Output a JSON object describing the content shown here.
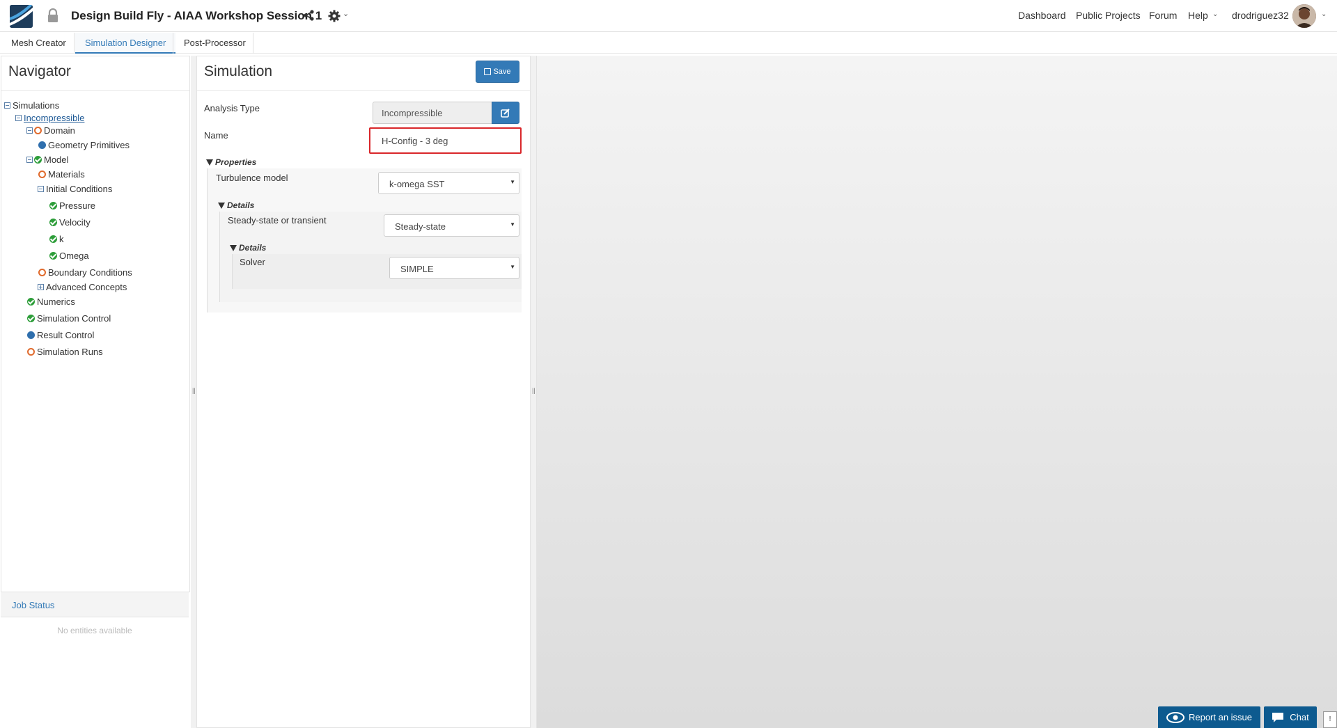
{
  "header": {
    "project_title": "Design Build Fly - AIAA Workshop Session 1",
    "nav": {
      "dashboard": "Dashboard",
      "public_projects": "Public Projects",
      "forum": "Forum",
      "help": "Help",
      "username": "drodriguez32"
    }
  },
  "tabs": [
    {
      "label": "Mesh Creator"
    },
    {
      "label": "Simulation Designer"
    },
    {
      "label": "Post-Processor"
    }
  ],
  "navigator": {
    "title": "Navigator",
    "tree": {
      "simulations": "Simulations",
      "incompressible": "Incompressible",
      "domain": "Domain",
      "geometry_primitives": "Geometry Primitives",
      "model": "Model",
      "materials": "Materials",
      "initial_conditions": "Initial Conditions",
      "pressure": "Pressure",
      "velocity": "Velocity",
      "k": "k",
      "omega": "Omega",
      "boundary_conditions": "Boundary Conditions",
      "advanced_concepts": "Advanced Concepts",
      "numerics": "Numerics",
      "simulation_control": "Simulation Control",
      "result_control": "Result Control",
      "simulation_runs": "Simulation Runs"
    }
  },
  "job_status": {
    "title": "Job Status",
    "empty": "No entities available"
  },
  "simulation": {
    "title": "Simulation",
    "save_label": "Save",
    "analysis_type_label": "Analysis Type",
    "analysis_type_value": "Incompressible",
    "name_label": "Name",
    "name_value": "H-Config - 3 deg",
    "properties_label": "Properties",
    "turbulence_label": "Turbulence model",
    "turbulence_value": "k-omega SST",
    "details1_label": "Details",
    "steady_label": "Steady-state or transient",
    "steady_value": "Steady-state",
    "details2_label": "Details",
    "solver_label": "Solver",
    "solver_value": "SIMPLE"
  },
  "footer": {
    "report_label": "Report an issue",
    "chat_label": "Chat",
    "corner_label": "!"
  },
  "colors": {
    "accent": "#337ab7",
    "ok": "#2e9e3a",
    "pending": "#e06a2c",
    "highlight": "#d9262a"
  }
}
